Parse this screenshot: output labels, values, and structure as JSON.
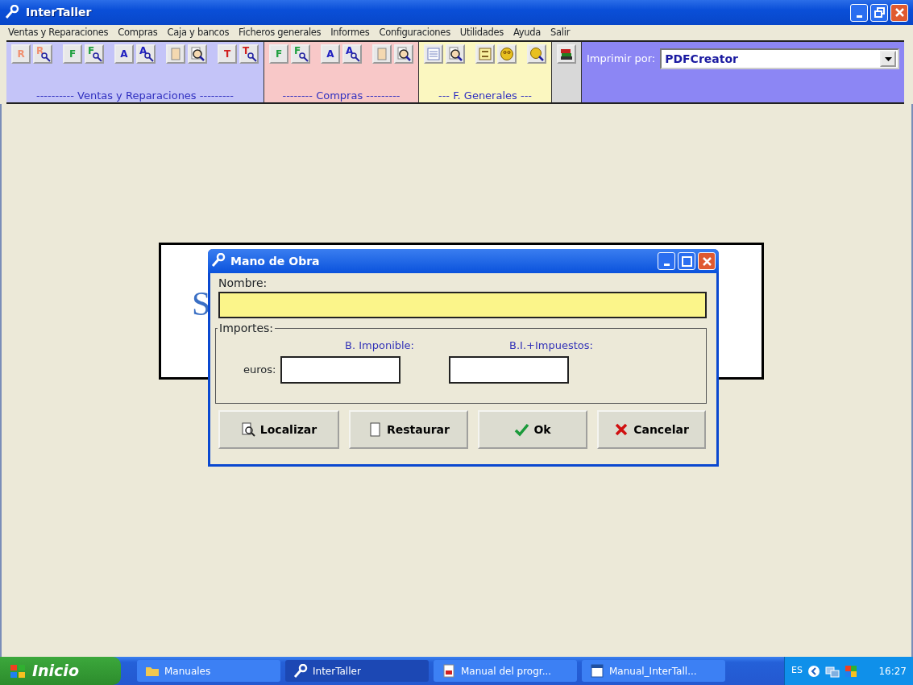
{
  "window": {
    "title": "InterTaller"
  },
  "menu": [
    "Ventas y Reparaciones",
    "Compras",
    "Caja y bancos",
    "Ficheros generales",
    "Informes",
    "Configuraciones",
    "Utilidades",
    "Ayuda",
    "Salir"
  ],
  "toolbar": {
    "groups": [
      {
        "label": "---------- Ventas y Reparaciones ---------",
        "color": "#c4c4f8",
        "tools": [
          {
            "kind": "letter",
            "label": "R",
            "color": "#f09070"
          },
          {
            "kind": "find",
            "label": "R",
            "color": "#f09070"
          },
          {
            "kind": "letter",
            "label": "F",
            "color": "#20a040"
          },
          {
            "kind": "find",
            "label": "F",
            "color": "#20a040"
          },
          {
            "kind": "letter",
            "label": "A",
            "color": "#2020c0"
          },
          {
            "kind": "find",
            "label": "A",
            "color": "#2020c0"
          },
          {
            "kind": "blank"
          },
          {
            "kind": "find-blank"
          },
          {
            "kind": "letter",
            "label": "T",
            "color": "#d02020"
          },
          {
            "kind": "find",
            "label": "T",
            "color": "#d02020"
          }
        ]
      },
      {
        "label": "-------- Compras ---------",
        "color": "#f8c8c8",
        "tools": [
          {
            "kind": "letter",
            "label": "F",
            "color": "#20a040"
          },
          {
            "kind": "find",
            "label": "F",
            "color": "#20a040"
          },
          {
            "kind": "letter",
            "label": "A",
            "color": "#2020c0"
          },
          {
            "kind": "find",
            "label": "A",
            "color": "#2020c0"
          },
          {
            "kind": "blank"
          },
          {
            "kind": "find-blank"
          }
        ]
      },
      {
        "label": "--- F. Generales ---",
        "color": "#fbf7c0",
        "tools": [
          {
            "kind": "sheet"
          },
          {
            "kind": "find-blank"
          },
          {
            "kind": "list"
          },
          {
            "kind": "face"
          },
          {
            "kind": "find-face"
          }
        ]
      }
    ],
    "extra_tool": {
      "kind": "stack"
    },
    "printer": {
      "label": "Imprimir por:",
      "value": "PDFCreator"
    }
  },
  "background_panel": {
    "text": "S"
  },
  "dialog": {
    "title": "Mano de Obra",
    "name_label": "Nombre:",
    "fieldset": "Importes:",
    "column_1": "B. Imponible:",
    "column_2": "B.I.+Impuestos:",
    "row_label": "euros:",
    "buttons": [
      {
        "label": "Localizar",
        "kind": "find"
      },
      {
        "label": "Restaurar",
        "kind": "page"
      },
      {
        "label": "Ok",
        "kind": "ok"
      },
      {
        "label": "Cancelar",
        "kind": "cancel"
      }
    ]
  },
  "taskbar": {
    "start": "Inicio",
    "tasks": [
      {
        "label": "Manuales",
        "kind": "folder",
        "selected": false
      },
      {
        "label": "InterTaller",
        "kind": "key",
        "selected": true
      },
      {
        "label": "Manual del progr...",
        "kind": "pdf",
        "selected": false
      },
      {
        "label": "Manual_InterTall...",
        "kind": "word",
        "selected": false
      }
    ],
    "language": "ES",
    "clock": "16:27"
  }
}
